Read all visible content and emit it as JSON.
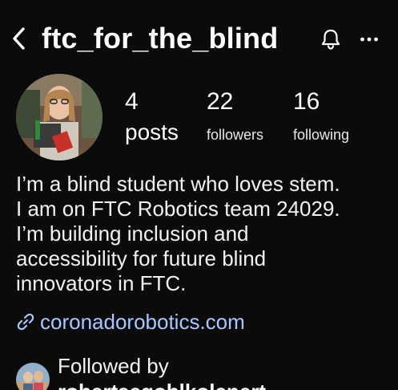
{
  "header": {
    "username": "ftc_for_the_blind",
    "back_icon": "chevron-left-icon",
    "bell_icon": "bell-icon",
    "more_icon": "ellipsis-icon"
  },
  "stats": {
    "posts": {
      "count": "4",
      "label": "posts"
    },
    "followers": {
      "count": "22",
      "label": "followers"
    },
    "following": {
      "count": "16",
      "label": "following"
    }
  },
  "bio": {
    "lines": [
      "I’m a blind student who loves stem.",
      "I am on FTC Robotics team 24029.",
      "I’m building inclusion and",
      "accessibility for future blind",
      "innovators in FTC."
    ]
  },
  "link": {
    "icon": "link-icon",
    "text": "coronadorobotics.com"
  },
  "followed_by": {
    "label": "Followed by",
    "name": "robertaegoblkolenert"
  },
  "colors": {
    "background": "#0b0b0c",
    "text": "#ffffff",
    "link": "#a7c8ff"
  }
}
